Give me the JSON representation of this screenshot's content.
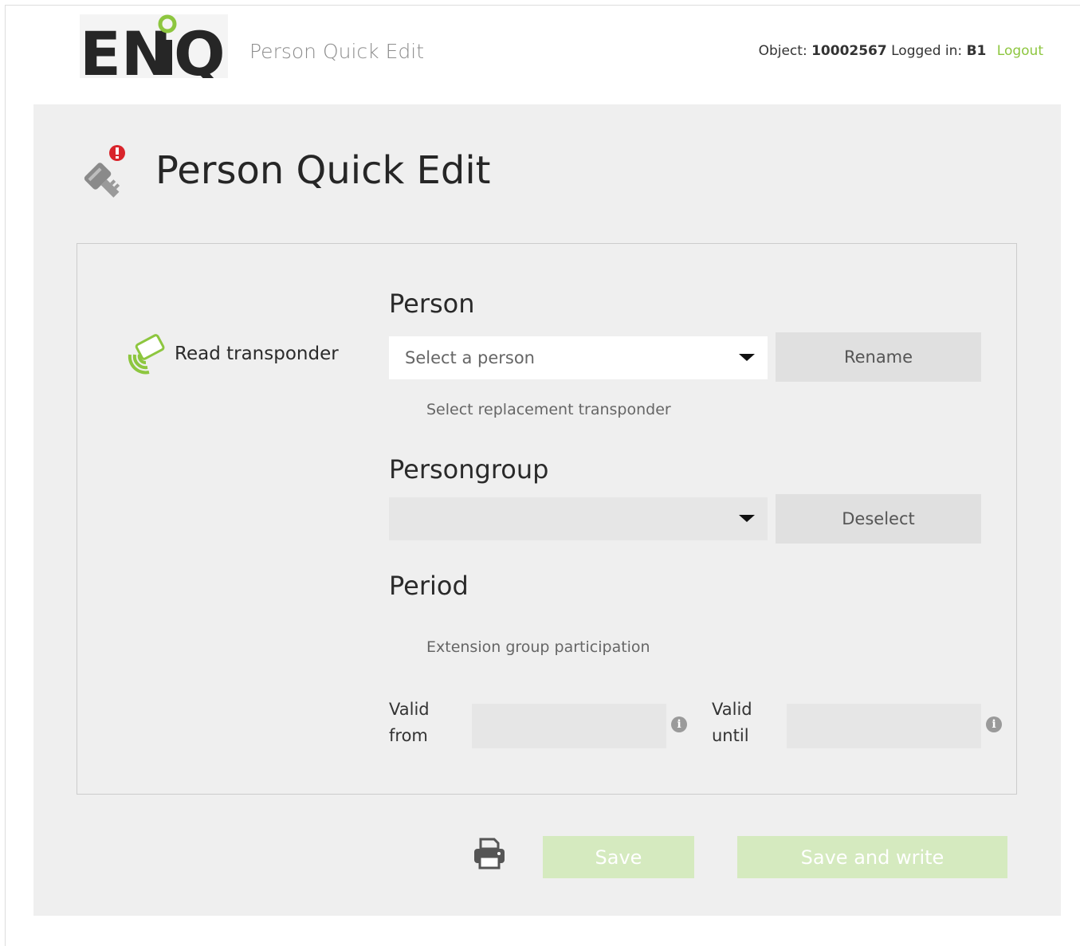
{
  "header": {
    "logo_text": "ENiQ",
    "app_title": "Person Quick Edit",
    "object_label": "Object:",
    "object_value": "10002567",
    "logged_label": "Logged in:",
    "logged_value": "B1",
    "logout_label": "Logout"
  },
  "page": {
    "title": "Person Quick Edit",
    "icon": "key-alert-icon"
  },
  "form": {
    "read_transponder_label": "Read transponder",
    "person": {
      "section_label": "Person",
      "select_placeholder": "Select a person",
      "rename_label": "Rename",
      "replacement_link": "Select replacement transponder"
    },
    "persongroup": {
      "section_label": "Persongroup",
      "select_value": "",
      "deselect_label": "Deselect"
    },
    "period": {
      "section_label": "Period",
      "extension_link": "Extension group participation",
      "valid_from_label_1": "Valid",
      "valid_from_label_2": "from",
      "valid_from_value": "",
      "valid_until_label_1": "Valid",
      "valid_until_label_2": "until",
      "valid_until_value": ""
    }
  },
  "footer": {
    "print_icon": "printer-icon",
    "save_label": "Save",
    "save_write_label": "Save and write"
  },
  "colors": {
    "accent_green": "#8dc63f",
    "disabled_green": "#d5eabf",
    "panel_bg": "#efefef",
    "button_gray": "#e0e0e0"
  }
}
